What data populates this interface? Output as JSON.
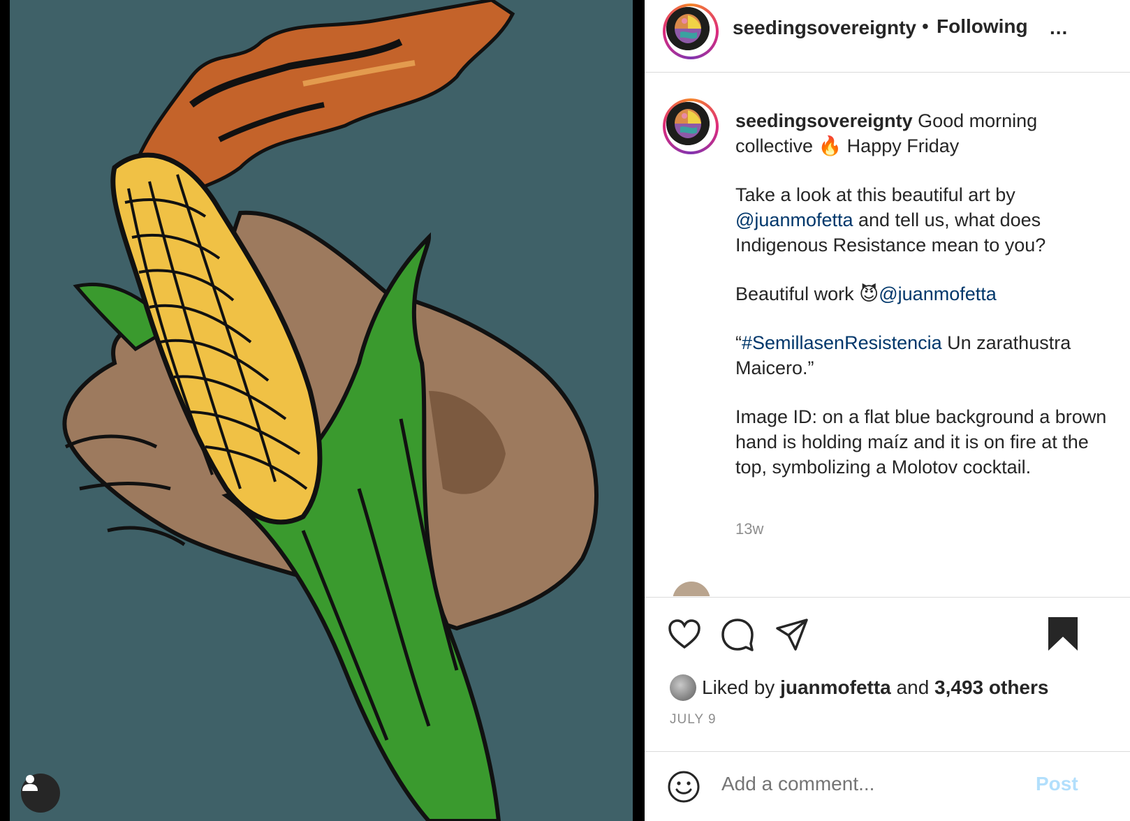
{
  "header": {
    "username": "seedingsovereignty",
    "separator": "•",
    "follow_status": "Following",
    "more": "..."
  },
  "caption": {
    "username": "seedingsovereignty",
    "line1": " Good morning collective ",
    "emoji_fire": "🔥",
    "line1_end": " Happy Friday",
    "para2_start": "Take a look at this beautiful art by ",
    "mention1": "@juanmofetta",
    "para2_end": " and tell us, what does Indigenous Resistance mean to you?",
    "para3_start": "Beautiful work ",
    "emoji_devil": "😈",
    "mention2": "@juanmofetta",
    "para4_quote_open": "“",
    "hashtag": "#SemillasenResistencia",
    "para4_end": " Un zarathustra Maicero.”",
    "para5": "Image ID: on a flat blue background a brown hand is holding maíz and it is on fire at the top, symbolizing a Molotov cocktail.",
    "time_ago": "13w"
  },
  "likes": {
    "prefix": "Liked by ",
    "user": "juanmofetta",
    "middle": " and ",
    "count": "3,493 others"
  },
  "date": "JULY 9",
  "comment": {
    "placeholder": "Add a comment...",
    "post": "Post"
  },
  "icons": {
    "like": "heart-icon",
    "comment": "comment-icon",
    "share": "paper-plane-icon",
    "save": "bookmark-icon",
    "emoji": "smiley-icon",
    "tag": "user-icon"
  },
  "colors": {
    "background_art": "#3f6168",
    "link": "#00376b",
    "post_disabled": "#b2dffc"
  }
}
